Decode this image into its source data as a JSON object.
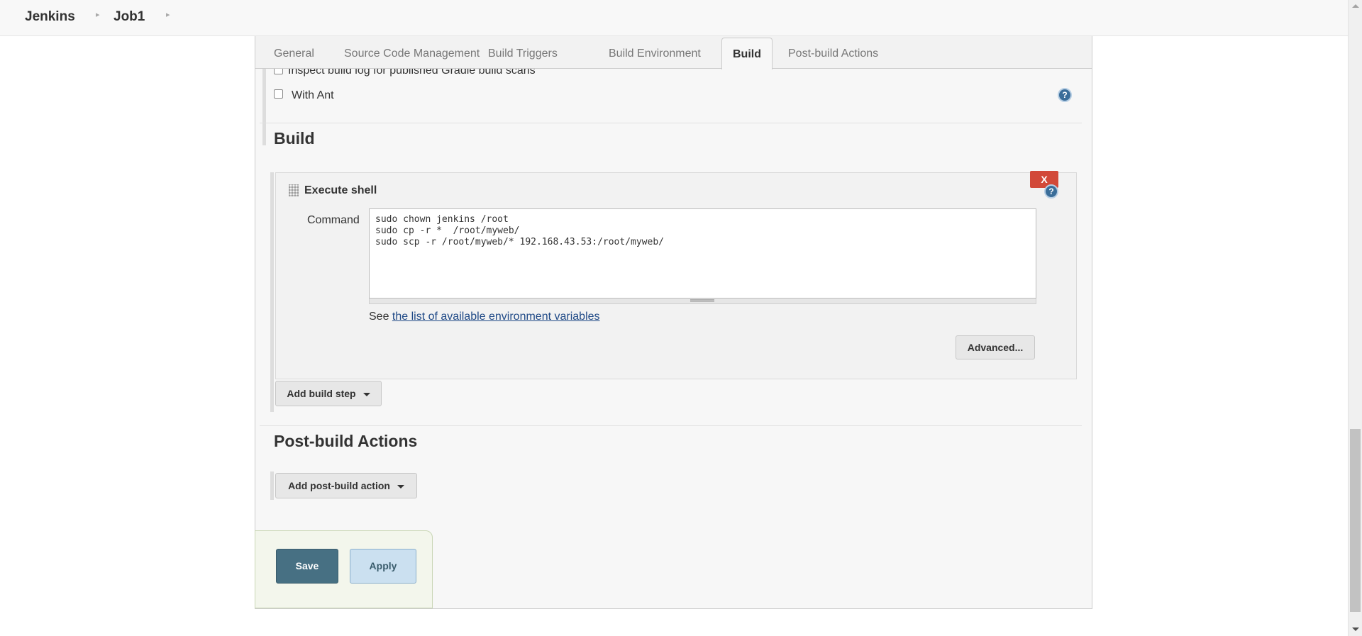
{
  "breadcrumb": {
    "items": [
      "Jenkins",
      "Job1"
    ]
  },
  "tabs": [
    {
      "label": "General"
    },
    {
      "label": "Source Code Management"
    },
    {
      "label": "Build Triggers"
    },
    {
      "label": "Build Environment"
    },
    {
      "label": "Build",
      "active": true
    },
    {
      "label": "Post-build Actions"
    }
  ],
  "options": {
    "gradle_scans_label": "Inspect build log for published Gradle build scans",
    "with_ant_label": "With Ant"
  },
  "build_section": {
    "title": "Build",
    "step": {
      "title": "Execute shell",
      "delete_label": "X",
      "command_label": "Command",
      "command_value": "sudo chown jenkins /root\nsudo cp -r *  /root/myweb/\nsudo scp -r /root/myweb/* 192.168.43.53:/root/myweb/",
      "env_prefix": "See ",
      "env_link": "the list of available environment variables",
      "advanced_label": "Advanced..."
    },
    "add_step_label": "Add build step"
  },
  "post_build_section": {
    "title": "Post-build Actions",
    "add_action_label": "Add post-build action"
  },
  "footer": {
    "save_label": "Save",
    "apply_label": "Apply"
  },
  "help_glyph": "?",
  "icons": [
    "chevron-right-icon",
    "help-icon",
    "drag-handle-icon",
    "caret-down-icon",
    "resize-grip-icon"
  ],
  "colors": {
    "save": "#477083",
    "apply": "#cbe0f0",
    "delete": "#d24939",
    "link": "#204a87",
    "help": "#3a6d99"
  }
}
